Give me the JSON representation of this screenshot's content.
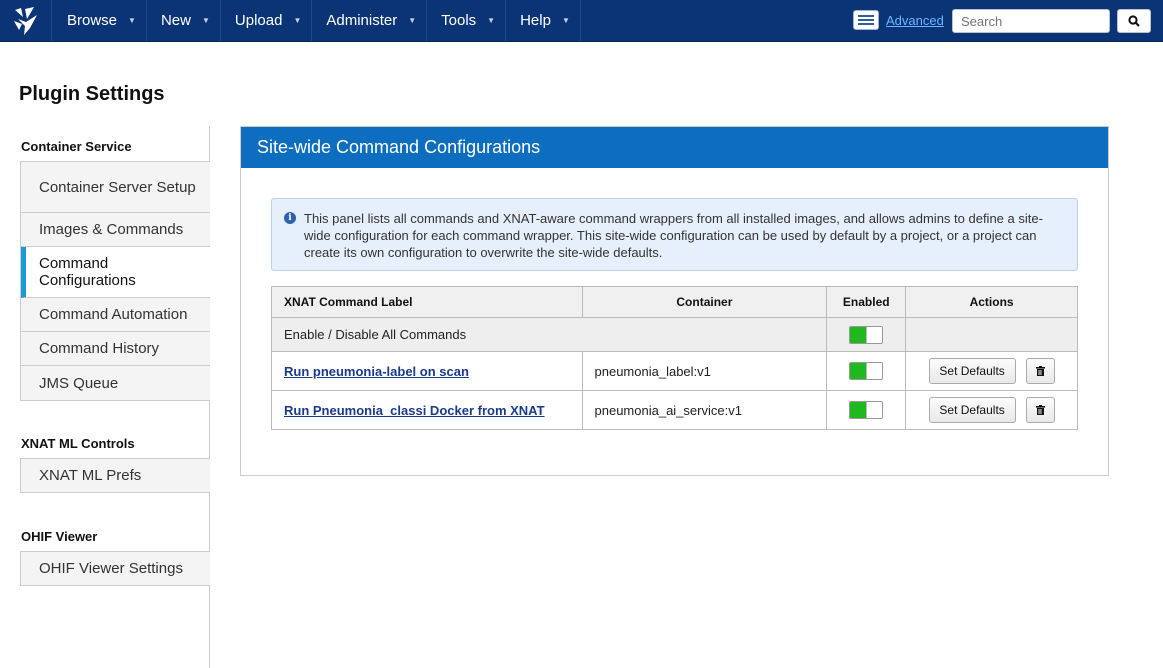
{
  "nav": {
    "items": [
      "Browse",
      "New",
      "Upload",
      "Administer",
      "Tools",
      "Help"
    ],
    "advanced_label": "Advanced",
    "search_placeholder": "Search"
  },
  "page": {
    "title": "Plugin Settings"
  },
  "sidebar": {
    "sections": [
      {
        "heading": "Container Service",
        "items": [
          "Container Server Setup",
          "Images & Commands",
          "Command Configurations",
          "Command Automation",
          "Command History",
          "JMS Queue"
        ],
        "active": "Command Configurations"
      },
      {
        "heading": "XNAT ML Controls",
        "items": [
          "XNAT ML Prefs"
        ]
      },
      {
        "heading": "OHIF Viewer",
        "items": [
          "OHIF Viewer Settings"
        ]
      }
    ]
  },
  "panel": {
    "title": "Site-wide Command Configurations",
    "info_text": "This panel lists all commands and XNAT-aware command wrappers from all installed images, and allows admins to define a site-wide configuration for each command wrapper. This site-wide configuration can be used by default by a project, or a project can create its own configuration to overwrite the site-wide defaults.",
    "table": {
      "headers": {
        "label": "XNAT Command Label",
        "container": "Container",
        "enabled": "Enabled",
        "actions": "Actions"
      },
      "all_row_label": "Enable / Disable All Commands",
      "rows": [
        {
          "label": "Run pneumonia-label on scan",
          "container": "pneumonia_label:v1",
          "enabled": true
        },
        {
          "label": "Run Pneumonia_classi Docker from XNAT",
          "container": "pneumonia_ai_service:v1",
          "enabled": true
        }
      ],
      "set_defaults_label": "Set Defaults"
    }
  },
  "colors": {
    "nav_bg": "#0a3476",
    "panel_header": "#0d6dbf",
    "toggle_on": "#1fb81f",
    "active_marker": "#1a9ad6"
  }
}
